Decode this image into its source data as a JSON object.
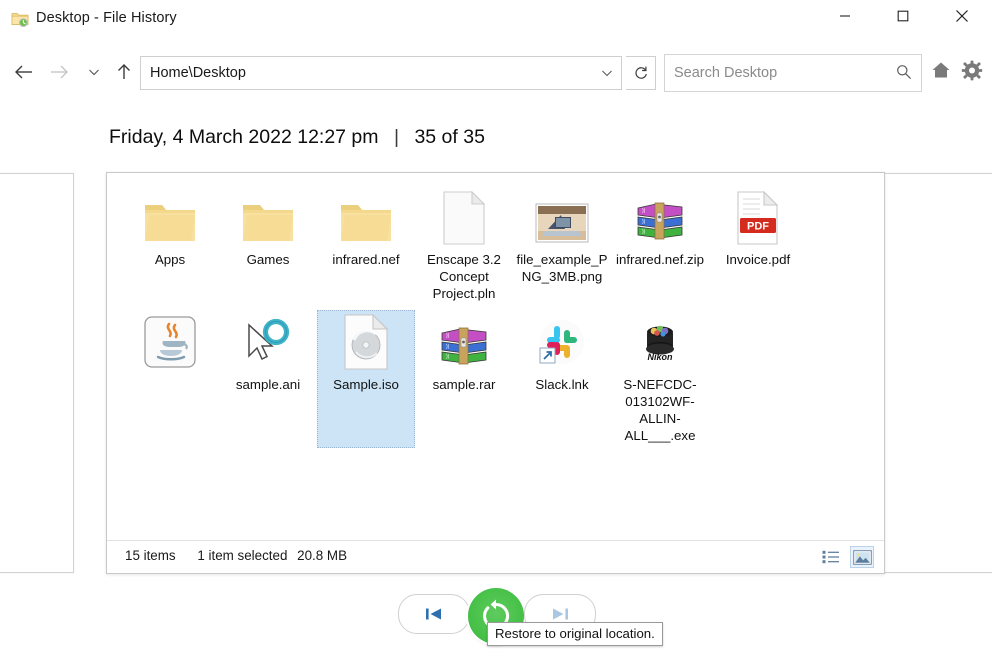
{
  "window": {
    "title": "Desktop - File History",
    "title_icon": "folder-history-icon",
    "controls": {
      "minimize": "minimize-icon",
      "maximize": "maximize-icon",
      "close": "close-icon"
    }
  },
  "toolbar": {
    "back_icon": "arrow-left-icon",
    "forward_icon": "arrow-right-icon",
    "recent_icon": "chevron-down-icon",
    "up_icon": "arrow-up-icon",
    "address_value": "Home\\Desktop",
    "address_chevron_icon": "chevron-down-icon",
    "refresh_icon": "refresh-icon",
    "search_placeholder": "Search Desktop",
    "search_icon": "search-icon",
    "home_icon": "home-icon",
    "settings_icon": "gear-icon"
  },
  "header": {
    "date": "Friday, 4 March 2022 12:27 pm",
    "separator": "|",
    "counter": "35 of 35"
  },
  "files": [
    {
      "name": "Apps",
      "icon": "folder-icon",
      "selected": false
    },
    {
      "name": "Games",
      "icon": "folder-icon",
      "selected": false
    },
    {
      "name": "infrared.nef",
      "icon": "folder-icon",
      "selected": false
    },
    {
      "name": "Enscape 3.2 Concept Project.pln",
      "icon": "blank-document-icon",
      "selected": false
    },
    {
      "name": "file_example_PNG_3MB.png",
      "icon": "png-thumbnail-icon",
      "selected": false
    },
    {
      "name": "infrared.nef.zip",
      "icon": "winrar-archive-icon",
      "selected": false
    },
    {
      "name": "Invoice.pdf",
      "icon": "pdf-icon",
      "selected": false
    },
    {
      "name": "",
      "icon": "java-icon",
      "selected": false
    },
    {
      "name": "sample.ani",
      "icon": "cursor-busy-icon",
      "selected": false
    },
    {
      "name": "Sample.iso",
      "icon": "disc-image-icon",
      "selected": true
    },
    {
      "name": "sample.rar",
      "icon": "winrar-archive-icon",
      "selected": false
    },
    {
      "name": "Slack.lnk",
      "icon": "slack-shortcut-icon",
      "selected": false
    },
    {
      "name": "S-NEFCDC-013102WF-ALLIN-ALL___.exe",
      "icon": "nikon-installer-icon",
      "selected": false
    }
  ],
  "statusbar": {
    "item_count": "15 items",
    "selection": "1 item selected",
    "size": "20.8 MB",
    "view_details_icon": "details-view-icon",
    "view_large_icons_icon": "large-icons-view-icon"
  },
  "transport": {
    "previous_icon": "previous-version-icon",
    "restore_icon": "restore-circular-arrow-icon",
    "next_icon": "next-version-icon",
    "tooltip": "Restore to original location."
  },
  "colors": {
    "selection_blue": "#cce4f6",
    "restore_green": "#49c24a",
    "accent_blue": "#2f6fb0",
    "pdf_red": "#d52b1e"
  }
}
